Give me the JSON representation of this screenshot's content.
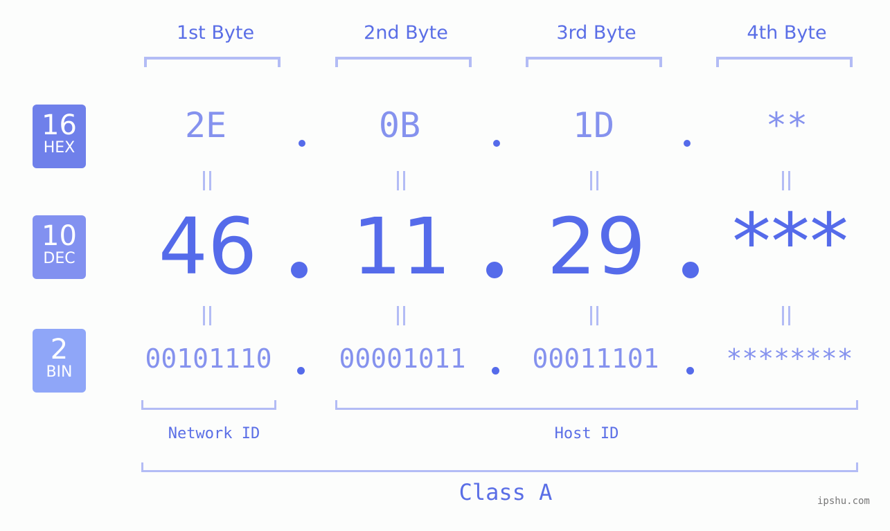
{
  "bytes": {
    "labels": [
      "1st Byte",
      "2nd Byte",
      "3rd Byte",
      "4th Byte"
    ]
  },
  "badges": {
    "hex": {
      "num": "16",
      "label": "HEX",
      "color": "#6f80ea"
    },
    "dec": {
      "num": "10",
      "label": "DEC",
      "color": "#8291f0"
    },
    "bin": {
      "num": "2",
      "label": "BIN",
      "color": "#8fa6f8"
    }
  },
  "hex": [
    "2E",
    "0B",
    "1D",
    "**"
  ],
  "dec": [
    "46",
    "11",
    "29",
    "***"
  ],
  "bin": [
    "00101110",
    "00001011",
    "00011101",
    "********"
  ],
  "ids": {
    "network": "Network ID",
    "host": "Host ID"
  },
  "class_label": "Class A",
  "watermark": "ipshu.com",
  "colors": {
    "accent": "#556bea",
    "light": "#8592ee",
    "bracket": "#b3bcf5"
  }
}
